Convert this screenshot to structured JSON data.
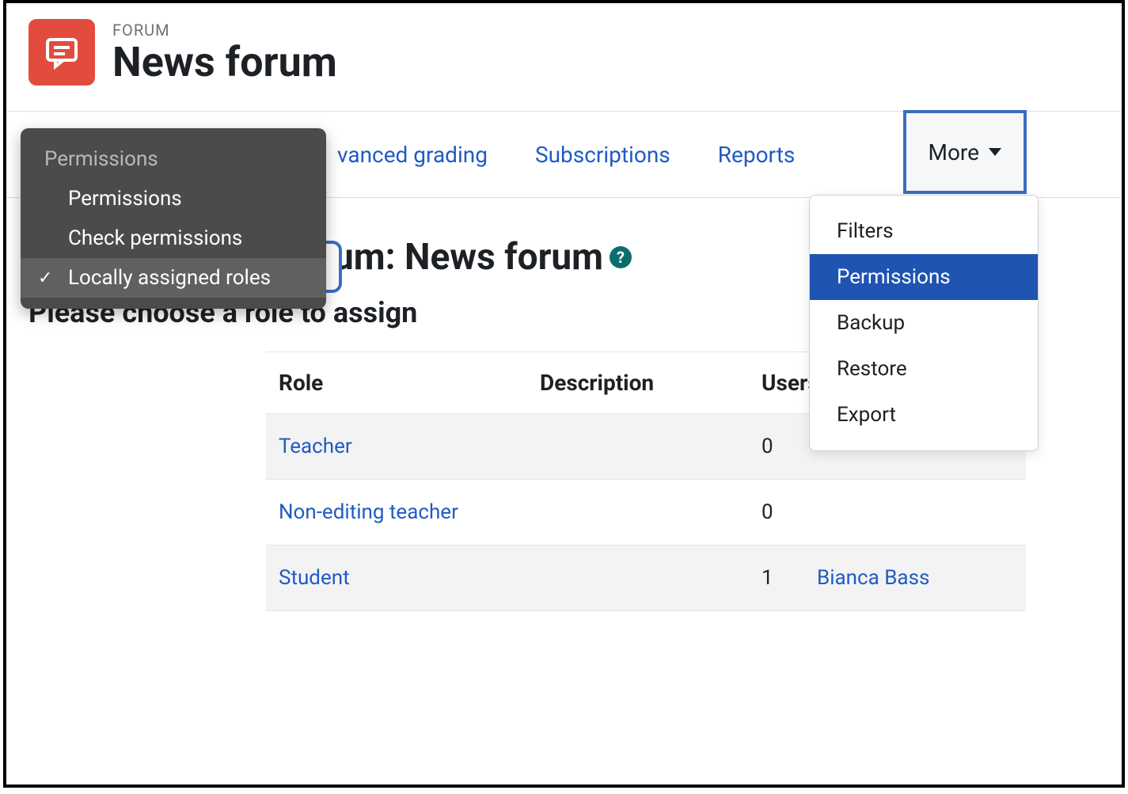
{
  "header": {
    "breadcrumb": "FORUM",
    "title": "News forum"
  },
  "tabs": {
    "advanced_grading": "vanced grading",
    "subscriptions": "Subscriptions",
    "reports": "Reports",
    "more": "More"
  },
  "more_menu": {
    "items": [
      {
        "label": "Filters",
        "active": false
      },
      {
        "label": "Permissions",
        "active": true
      },
      {
        "label": "Backup",
        "active": false
      },
      {
        "label": "Restore",
        "active": false
      },
      {
        "label": "Export",
        "active": false
      }
    ]
  },
  "perm_popover": {
    "group": "Permissions",
    "items": [
      {
        "label": "Permissions",
        "selected": false
      },
      {
        "label": "Check permissions",
        "selected": false
      },
      {
        "label": "Locally assigned roles",
        "selected": true
      }
    ]
  },
  "main": {
    "heading": "Assign roles in Forum: News forum",
    "subheading": "Please choose a role to assign",
    "columns": {
      "role": "Role",
      "description": "Description",
      "users": "Users with role"
    },
    "rows": [
      {
        "role": "Teacher",
        "description": "",
        "count": "0",
        "users": []
      },
      {
        "role": "Non-editing teacher",
        "description": "",
        "count": "0",
        "users": []
      },
      {
        "role": "Student",
        "description": "",
        "count": "1",
        "users": [
          "Bianca Bass"
        ]
      }
    ]
  }
}
